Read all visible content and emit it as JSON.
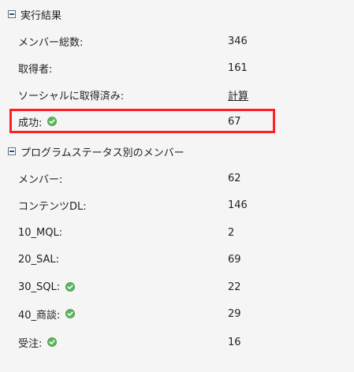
{
  "sections": [
    {
      "title": "実行結果",
      "rows": [
        {
          "label": "メンバー総数:",
          "value": "346"
        },
        {
          "label": "取得者:",
          "value": "161"
        },
        {
          "label": "ソーシャルに取得済み:",
          "value": "計算"
        },
        {
          "label": "成功:",
          "value": "67"
        }
      ]
    },
    {
      "title": "プログラムステータス別のメンバー",
      "rows": [
        {
          "label": "メンバー:",
          "value": "62"
        },
        {
          "label": "コンテンツDL:",
          "value": "146"
        },
        {
          "label": "10_MQL:",
          "value": "2"
        },
        {
          "label": "20_SAL:",
          "value": "69"
        },
        {
          "label": "30_SQL:",
          "value": "22"
        },
        {
          "label": "40_商談:",
          "value": "29"
        },
        {
          "label": "受注:",
          "value": "16"
        }
      ]
    }
  ],
  "icons": {
    "collapse": "collapse-minus-icon",
    "success": "green-check-icon"
  },
  "colors": {
    "success": "#5cb85c",
    "highlight": "#ff1f1f",
    "link": "#222222"
  }
}
